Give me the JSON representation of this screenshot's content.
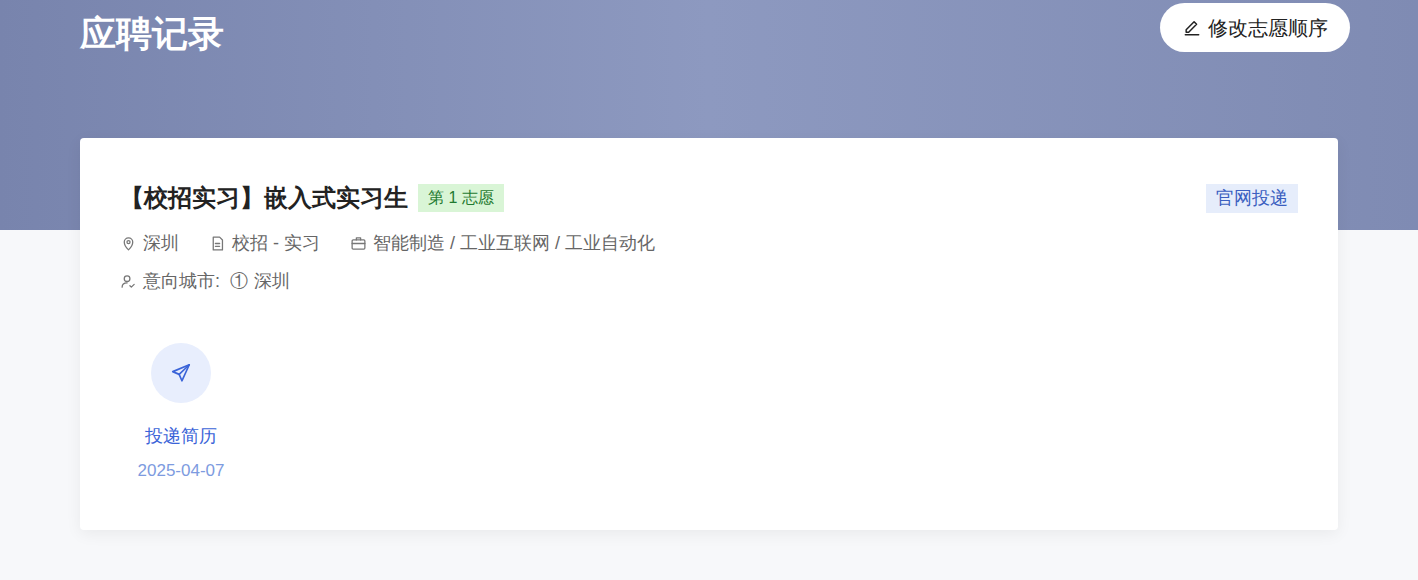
{
  "page": {
    "title": "应聘记录",
    "reorder_button": "修改志愿顺序"
  },
  "application": {
    "title": "【校招实习】嵌入式实习生",
    "preference": "第 1 志愿",
    "channel": "官网投递",
    "location": "深圳",
    "type": "校招 - 实习",
    "industry": "智能制造 / 工业互联网 / 工业自动化",
    "intent_label": "意向城市:",
    "intent_cities": [
      {
        "index": "①",
        "city": "深圳"
      }
    ]
  },
  "timeline": [
    {
      "label": "投递简历",
      "date": "2025-04-07"
    }
  ]
}
